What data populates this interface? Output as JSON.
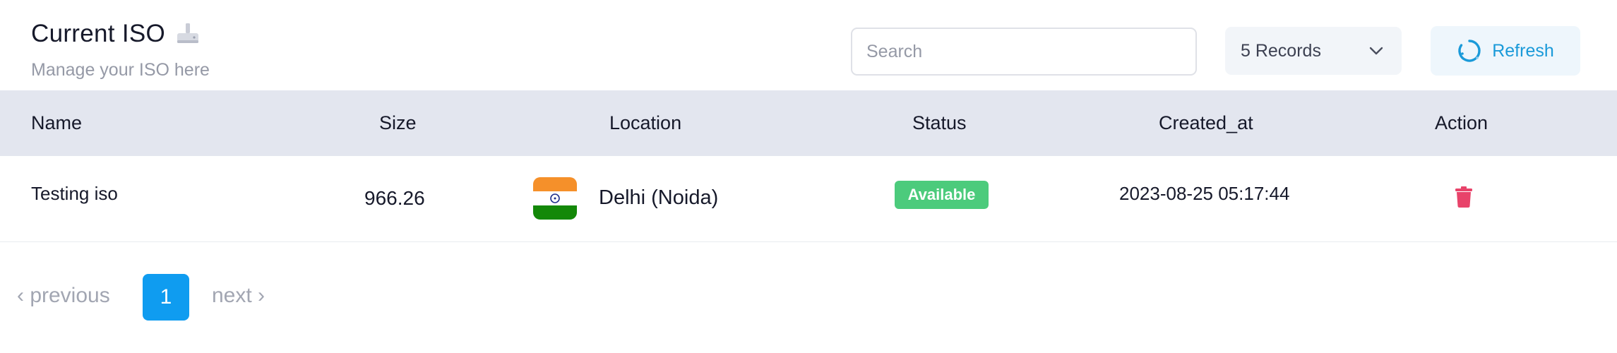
{
  "header": {
    "title": "Current ISO",
    "title_icon": "disk-drive-icon",
    "subtitle": "Manage your ISO here"
  },
  "search": {
    "placeholder": "Search",
    "value": ""
  },
  "records_select": {
    "selected": "5 Records"
  },
  "refresh": {
    "label": "Refresh"
  },
  "table": {
    "columns": [
      "Name",
      "Size",
      "Location",
      "Status",
      "Created_at",
      "Action"
    ],
    "rows": [
      {
        "name": "Testing iso",
        "size": "966.26",
        "location": "Delhi (Noida)",
        "location_flag": "india-flag-icon",
        "status": "Available",
        "created_at": "2023-08-25 05:17:44",
        "action_icon": "trash-icon"
      }
    ]
  },
  "pagination": {
    "previous": "‹ previous",
    "current": "1",
    "next": "next ›"
  },
  "colors": {
    "accent": "#0f9cf0",
    "status_available": "#4ccb7c",
    "delete": "#e8436a",
    "table_header_bg": "#e3e6ef"
  }
}
